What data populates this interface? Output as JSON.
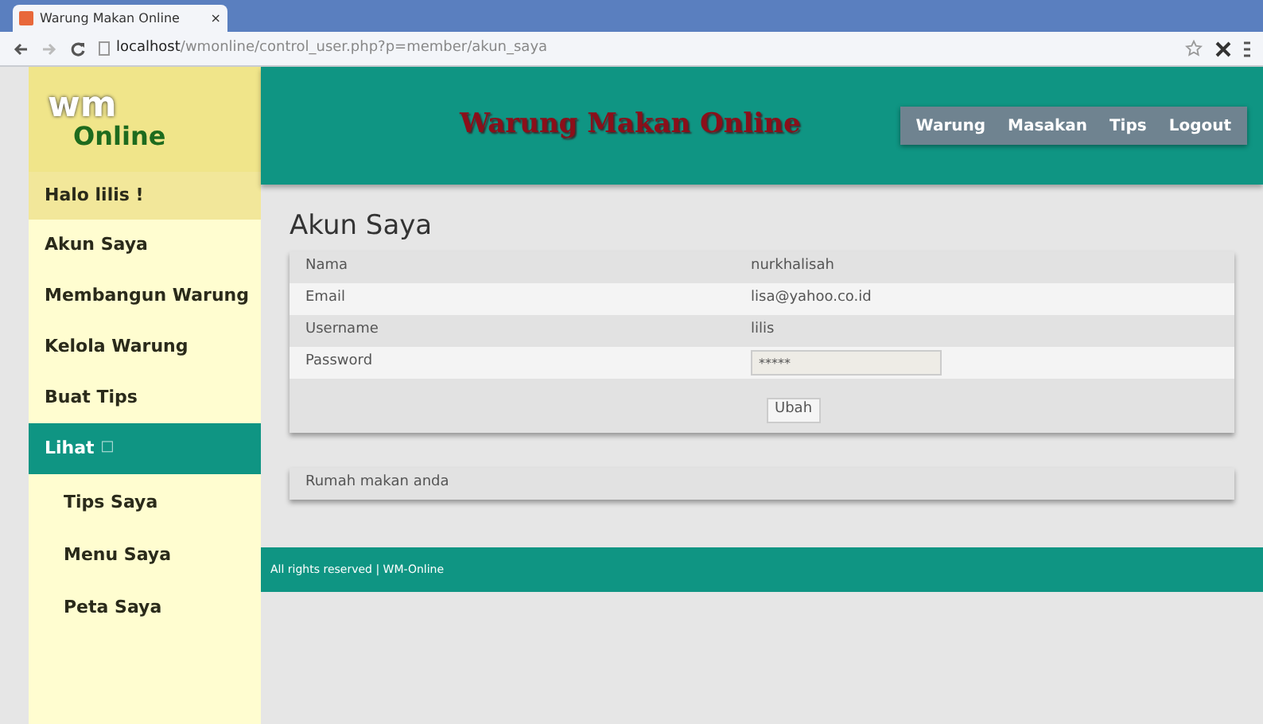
{
  "browser": {
    "tab_title": "Warung Makan Online",
    "tab_close": "×",
    "url_host": "localhost",
    "url_path": "/wmonline/control_user.php?p=member/akun_saya"
  },
  "logo": {
    "mark": "wm",
    "name": "Online"
  },
  "banner": {
    "title": "Warung Makan Online"
  },
  "top_nav": [
    "Warung",
    "Masakan",
    "Tips",
    "Logout"
  ],
  "sidebar": {
    "greeting": "Halo lilis !",
    "items": [
      {
        "label": "Akun Saya",
        "selected": false
      },
      {
        "label": "Membangun Warung",
        "selected": false
      },
      {
        "label": "Kelola Warung",
        "selected": false
      },
      {
        "label": "Buat Tips",
        "selected": false
      },
      {
        "label": "Lihat",
        "icon": "□",
        "selected": true,
        "children": [
          {
            "label": "Tips Saya",
            "selected": false
          },
          {
            "label": "Menu Saya",
            "selected": false
          },
          {
            "label": "Peta Saya",
            "selected": false
          }
        ]
      }
    ]
  },
  "page": {
    "title": "Akun Saya",
    "fields": [
      {
        "kind": "text",
        "label": "Nama",
        "value": "nurkhalisah"
      },
      {
        "kind": "text",
        "label": "Email",
        "value": "lisa@yahoo.co.id"
      },
      {
        "kind": "text",
        "label": "Username",
        "value": "lilis"
      },
      {
        "kind": "password",
        "label": "Password",
        "value": "*****"
      }
    ],
    "submit": "Ubah",
    "panel": "Rumah makan anda"
  },
  "footer": "All rights reserved | WM-Online"
}
